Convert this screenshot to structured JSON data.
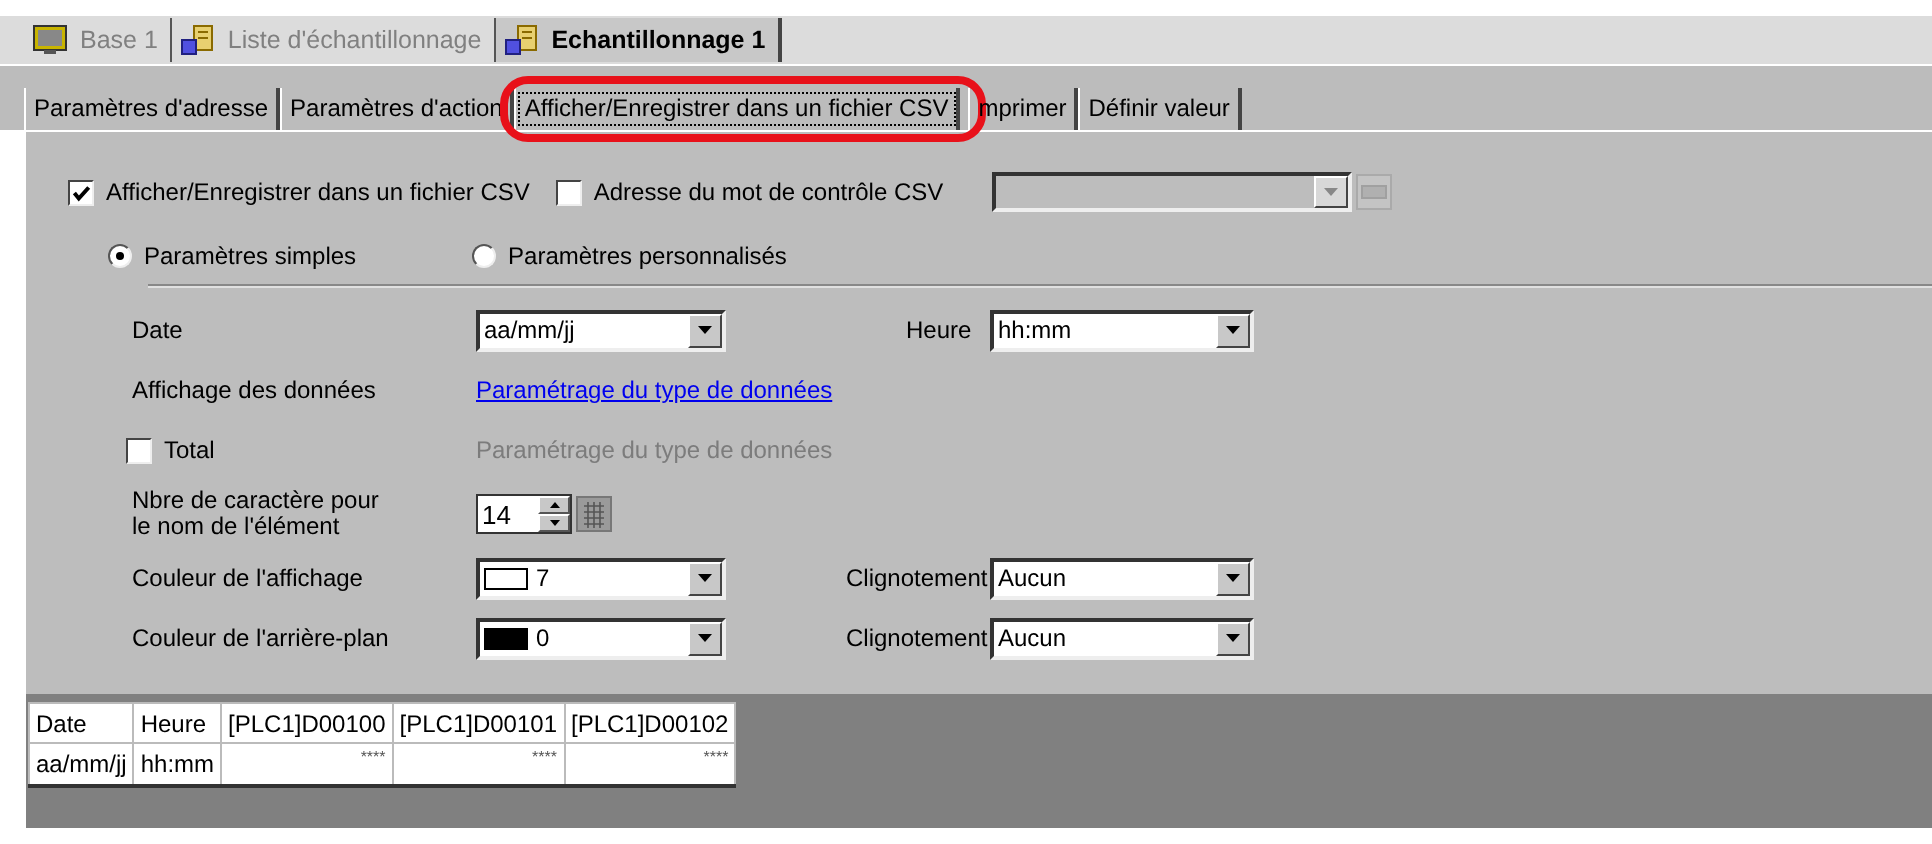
{
  "doc_tabs": [
    {
      "label": "Base 1",
      "kind": "screen",
      "selected": false
    },
    {
      "label": "Liste d'échantillonnage",
      "kind": "sampling",
      "selected": false
    },
    {
      "label": "Echantillonnage 1",
      "kind": "sampling",
      "selected": true
    }
  ],
  "tabs": [
    {
      "label": "Paramètres d'adresse",
      "selected": false
    },
    {
      "label": "Paramètres d'action",
      "selected": false
    },
    {
      "label": "Afficher/Enregistrer dans un fichier CSV",
      "selected": true
    },
    {
      "label": "mprimer",
      "selected": false
    },
    {
      "label": "Définir valeur",
      "selected": false
    }
  ],
  "csv_checkbox": {
    "label": "Afficher/Enregistrer dans un fichier CSV",
    "checked": true
  },
  "control_word_checkbox": {
    "label": "Adresse du mot de contrôle CSV",
    "checked": false
  },
  "control_word_dropdown": {
    "disabled": true
  },
  "modes": [
    {
      "label": "Paramètres simples",
      "selected": true
    },
    {
      "label": "Paramètres personnalisés",
      "selected": false
    }
  ],
  "date": {
    "label": "Date",
    "value": "aa/mm/jj"
  },
  "time": {
    "label": "Heure",
    "value": "hh:mm"
  },
  "data_display": {
    "label": "Affichage des données",
    "link": "Paramétrage du type de données"
  },
  "total": {
    "label": "Total",
    "checked": false,
    "setting": "Paramétrage du type de données",
    "setting_disabled": true
  },
  "name_chars": {
    "label": "Nbre de caractère pour le nom de l'élément",
    "value": "14"
  },
  "colors": [
    {
      "label": "Couleur de l'affichage",
      "color": "#ffffff",
      "value": "7",
      "blink_label": "Clignotement",
      "blink": "Aucun"
    },
    {
      "label": "Couleur de l'arrière-plan",
      "color": "#000000",
      "value": "0",
      "blink_label": "Clignotement",
      "blink": "Aucun"
    }
  ],
  "table": {
    "columns": [
      "Date",
      "Heure",
      "[PLC1]D00100",
      "[PLC1]D00101",
      "[PLC1]D00102"
    ],
    "rows": [
      [
        "aa/mm/jj",
        "hh:mm",
        "****",
        "****",
        "****"
      ]
    ]
  }
}
